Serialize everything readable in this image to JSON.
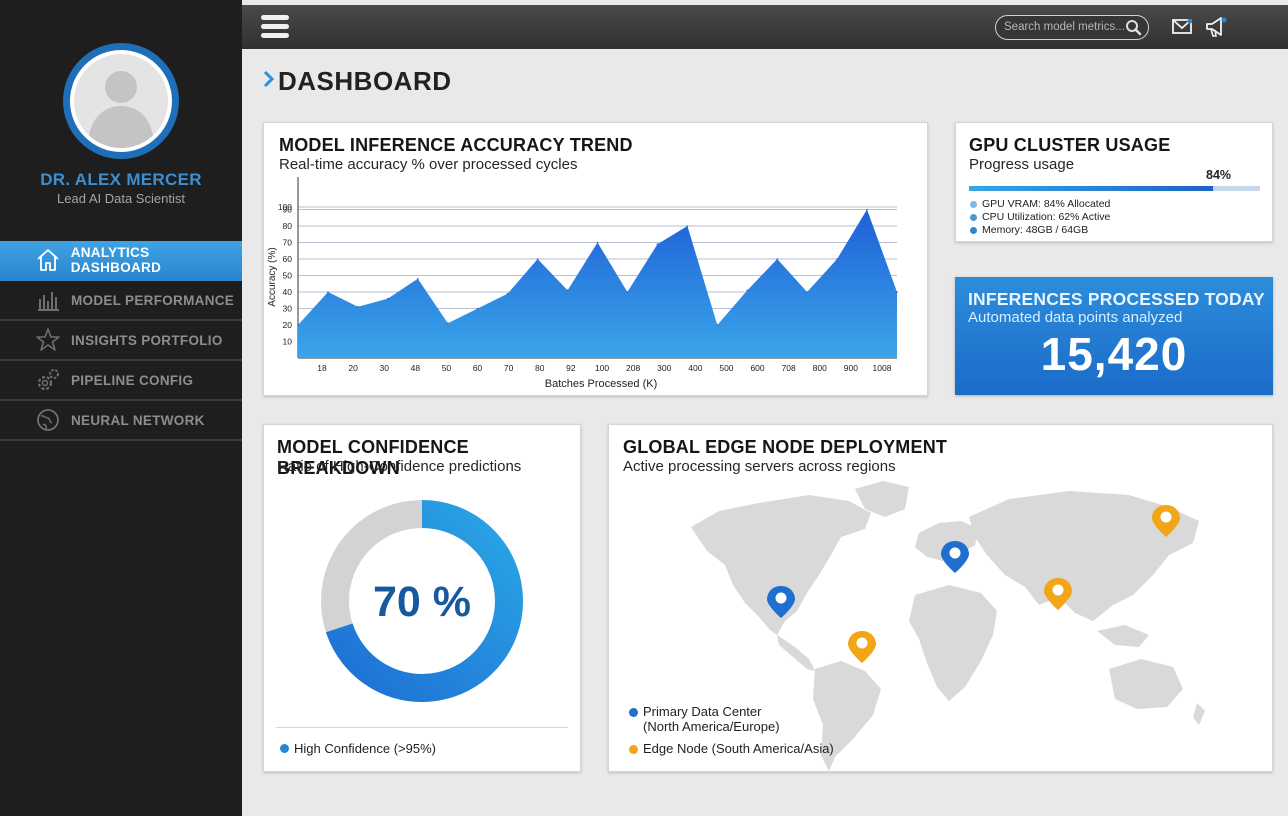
{
  "user": {
    "name": "DR. ALEX MERCER",
    "role": "Lead AI Data Scientist"
  },
  "sidebar": {
    "items": [
      {
        "label": "ANALYTICS DASHBOARD",
        "icon": "home-icon",
        "active": true
      },
      {
        "label": "MODEL PERFORMANCE",
        "icon": "bar-chart-icon",
        "active": false
      },
      {
        "label": "INSIGHTS PORTFOLIO",
        "icon": "star-icon",
        "active": false
      },
      {
        "label": "PIPELINE CONFIG",
        "icon": "gears-icon",
        "active": false
      },
      {
        "label": "NEURAL NETWORK",
        "icon": "globe-icon",
        "active": false
      }
    ]
  },
  "topbar": {
    "search_placeholder": "Search model metrics...",
    "icons": [
      "menu-icon",
      "search-icon",
      "mail-icon",
      "megaphone-icon"
    ]
  },
  "page": {
    "title": "DASHBOARD"
  },
  "trend": {
    "title": "MODEL INFERENCE ACCURACY TREND",
    "subtitle": "Real-time accuracy % over processed cycles"
  },
  "gpu": {
    "title": "GPU CLUSTER USAGE",
    "subtitle": "Progress usage",
    "percent_label": "84%",
    "progress": 0.84,
    "stats": [
      {
        "label": "GPU VRAM: 84% Allocated",
        "color": "#7fb9e3"
      },
      {
        "label": "CPU Utilization: 62% Active",
        "color": "#4a9ad6"
      },
      {
        "label": "Memory: 48GB / 64GB",
        "color": "#2f86c9"
      }
    ]
  },
  "inferences": {
    "title": "INFERENCES PROCESSED TODAY",
    "subtitle": "Automated data points analyzed",
    "value": "15,420"
  },
  "confidence": {
    "title": "MODEL CONFIDENCE BREAKDOWN",
    "subtitle": "Ratio of High-Confidence predictions",
    "value_label": "70 %",
    "fraction": 0.7,
    "legend": "High Confidence (>95%)"
  },
  "geo": {
    "title": "GLOBAL EDGE NODE DEPLOYMENT",
    "subtitle": "Active processing servers across regions",
    "legend": [
      {
        "label_line1": "Primary Data Center",
        "label_line2": "(North America/Europe)",
        "color": "#1f6fd0"
      },
      {
        "label_line1": "Edge Node (South America/Asia)",
        "label_line2": "",
        "color": "#f2a516"
      }
    ]
  },
  "colors": {
    "accent": "#2a86cf",
    "sidebar": "#1e1e1e",
    "primary_pin": "#1f6fd0",
    "edge_pin": "#f2a516"
  },
  "chart_data": {
    "type": "area",
    "title": "MODEL INFERENCE ACCURACY TREND",
    "subtitle": "Real-time accuracy % over processed cycles",
    "xlabel": "Batches Processed (K)",
    "ylabel": "Accuracy (%)",
    "ylim": [
      0,
      100
    ],
    "yticks": [
      10,
      20,
      30,
      40,
      50,
      60,
      70,
      80,
      90,
      100
    ],
    "xtick_labels": [
      "18",
      "20",
      "30",
      "48",
      "50",
      "60",
      "70",
      "80",
      "92",
      "100",
      "208",
      "300",
      "400",
      "500",
      "600",
      "708",
      "800",
      "900",
      "1008"
    ],
    "grid": true,
    "series": [
      {
        "values": [
          20,
          40,
          31,
          36,
          48,
          21,
          30,
          39,
          60,
          41,
          70,
          40,
          69,
          80,
          20,
          41,
          60,
          40,
          60,
          90,
          40
        ]
      }
    ]
  }
}
